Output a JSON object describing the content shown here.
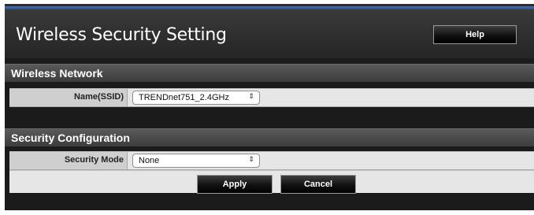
{
  "header": {
    "title": "Wireless Security Setting",
    "help_label": "Help"
  },
  "wireless_network": {
    "section_title": "Wireless Network",
    "ssid_label": "Name(SSID)",
    "ssid_value": "TRENDnet751_2.4GHz"
  },
  "security_configuration": {
    "section_title": "Security Configuration",
    "mode_label": "Security Mode",
    "mode_value": "None"
  },
  "actions": {
    "apply_label": "Apply",
    "cancel_label": "Cancel"
  },
  "icons": {
    "select_arrow": "updown-chevron-icon"
  },
  "colors": {
    "header_bg": "#2b2b2b",
    "section_bar_bg": "#4a4a4a",
    "row_bg": "#e6e6e6",
    "label_cell_bg": "#cfcfcf",
    "top_strip": "#3d5c9c"
  }
}
